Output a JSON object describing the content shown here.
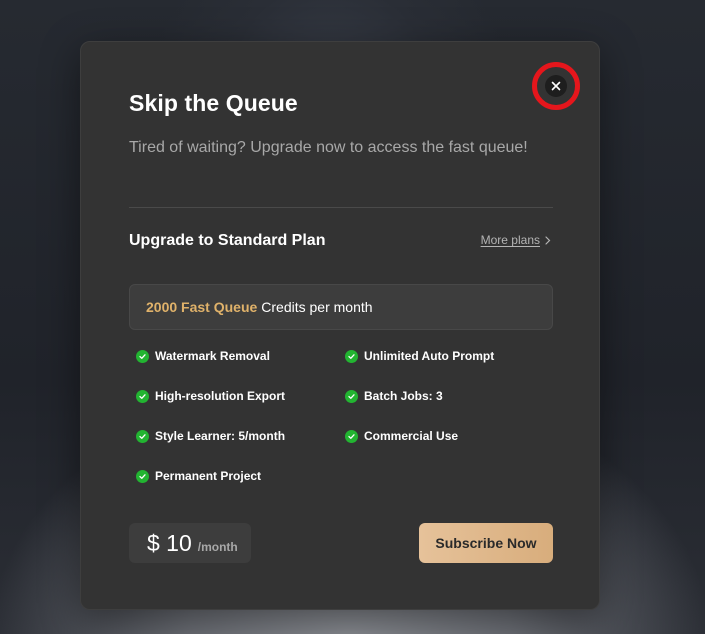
{
  "modal": {
    "title": "Skip the Queue",
    "subtitle": "Tired of waiting? Upgrade now to access the fast queue!",
    "close_icon": "close-icon",
    "plan_title": "Upgrade to Standard Plan",
    "more_plans_label": "More plans",
    "credits": {
      "highlight": "2000 Fast Queue",
      "text": "Credits per month"
    },
    "features": [
      "Watermark Removal",
      "Unlimited Auto Prompt",
      "High-resolution Export",
      "Batch Jobs: 3",
      "Style Learner: 5/month",
      "Commercial Use",
      "Permanent Project"
    ],
    "price": {
      "amount": "$ 10",
      "period": "/month"
    },
    "subscribe_label": "Subscribe Now"
  },
  "colors": {
    "accent_gold": "#e0b26a",
    "check_green": "#22b431",
    "highlight_ring": "#e5161c",
    "modal_bg": "#333333"
  }
}
